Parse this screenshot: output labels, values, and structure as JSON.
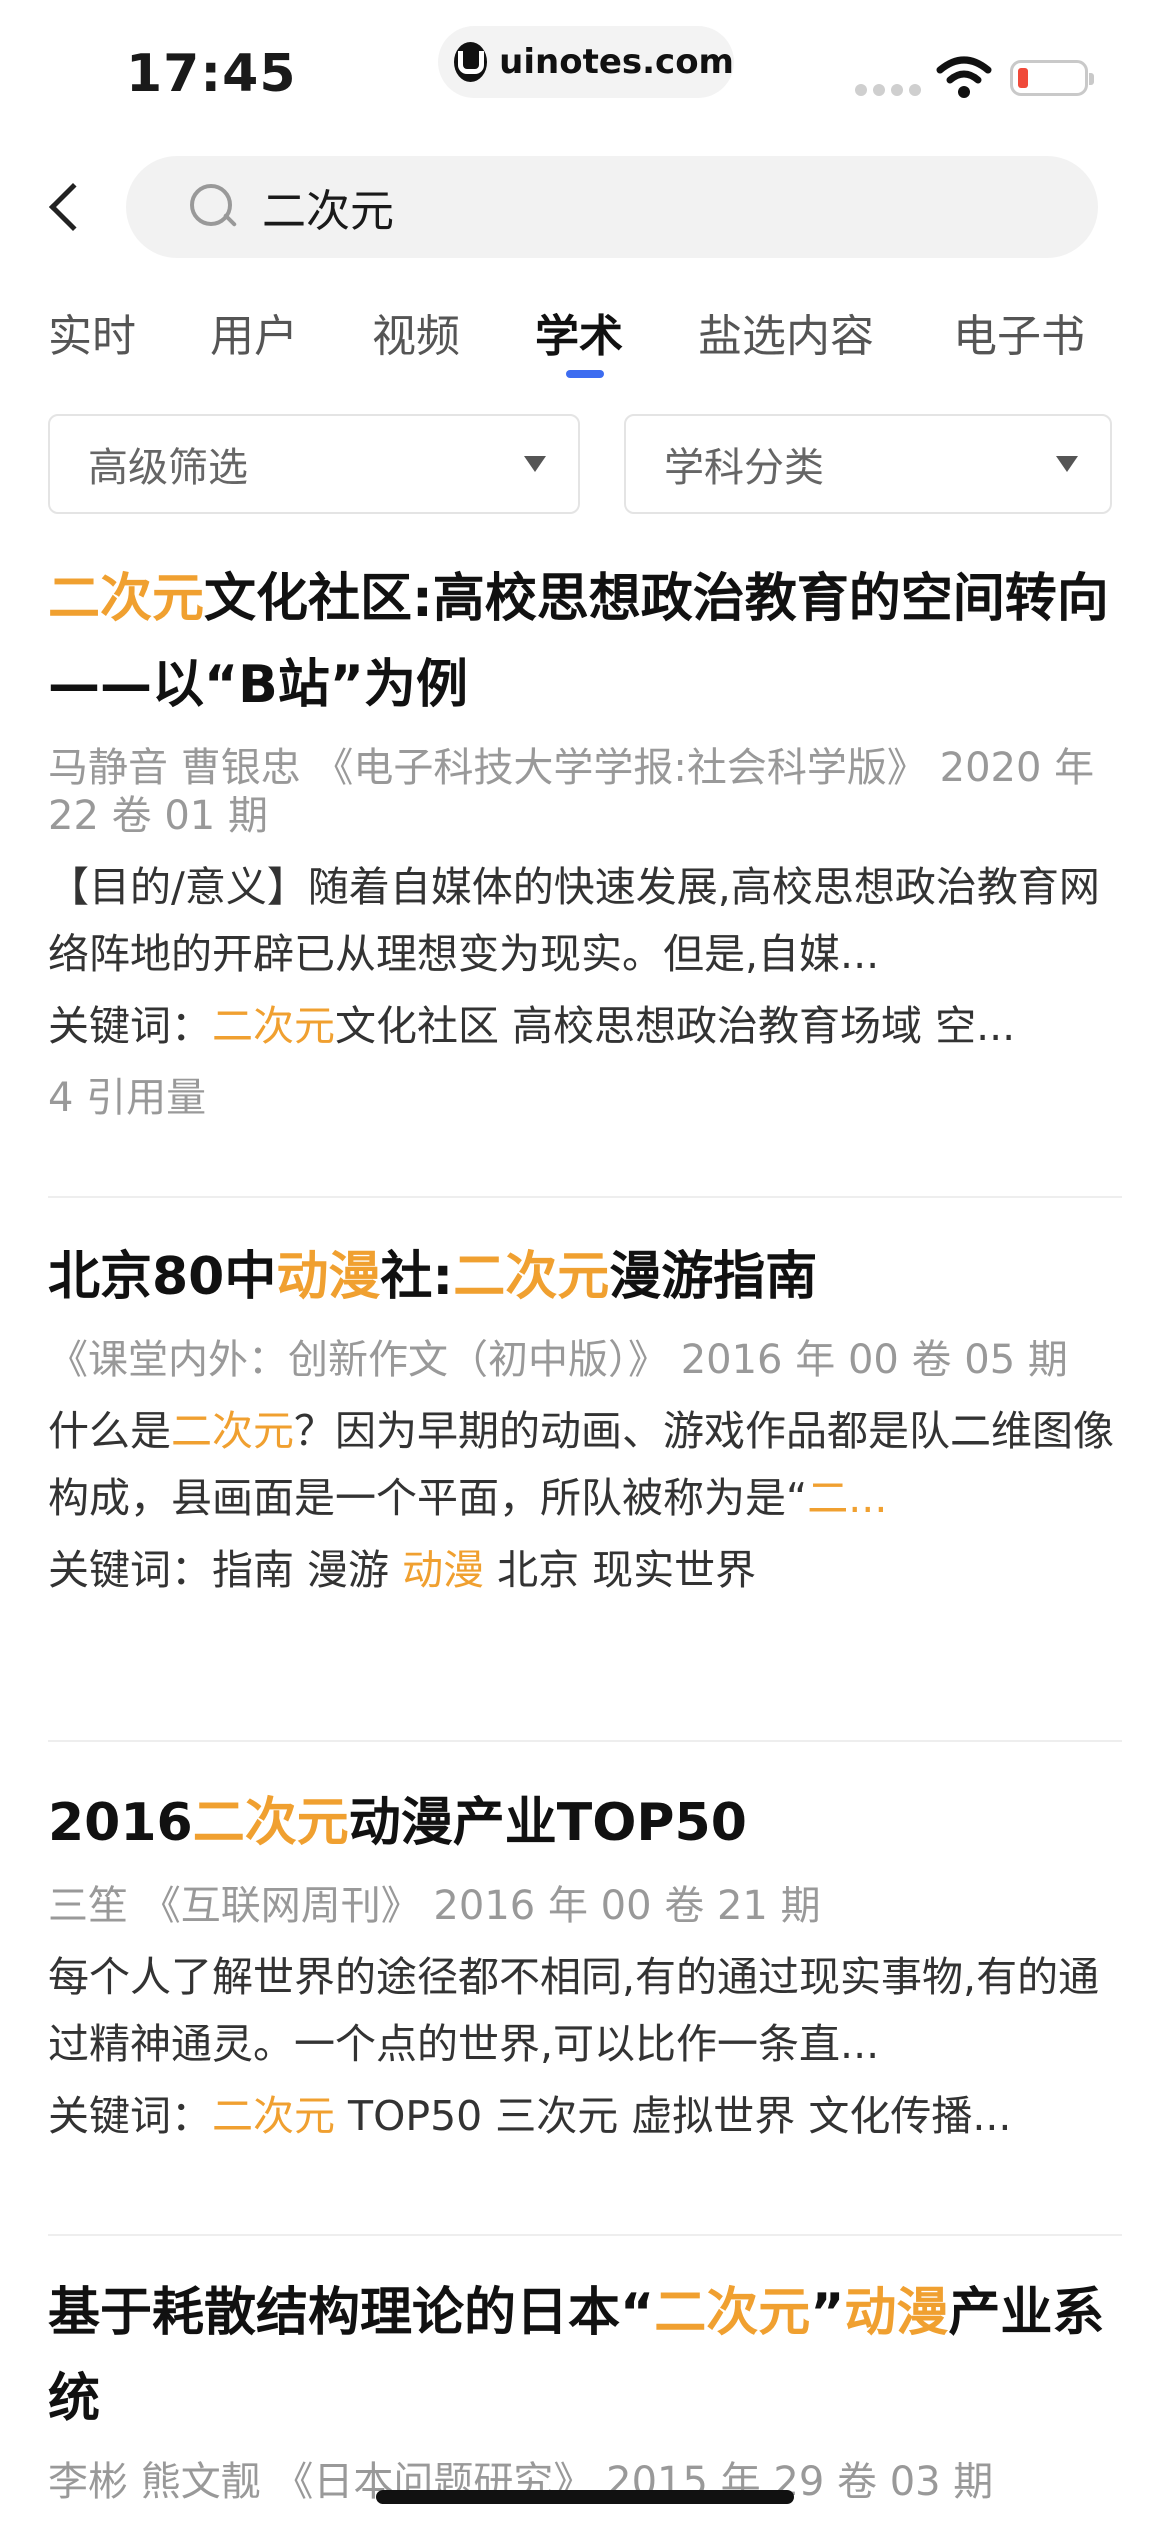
{
  "status_bar": {
    "time": "17:45",
    "url": "uinotes.com",
    "icons": [
      "cellular-signal-icon",
      "wifi-icon",
      "battery-low-icon"
    ]
  },
  "search": {
    "query": "二次元",
    "back_icon": "chevron-left-icon",
    "search_icon": "magnifier-icon"
  },
  "tabs": [
    {
      "label": "实时",
      "active": false
    },
    {
      "label": "用户",
      "active": false
    },
    {
      "label": "视频",
      "active": false
    },
    {
      "label": "学术",
      "active": true
    },
    {
      "label": "盐选内容",
      "active": false
    },
    {
      "label": "电子书",
      "active": false
    }
  ],
  "filters": [
    {
      "label": "高级筛选",
      "icon": "dropdown-caret-icon"
    },
    {
      "label": "学科分类",
      "icon": "dropdown-caret-icon"
    }
  ],
  "colors": {
    "highlight": "#f0a030",
    "tab_indicator": "#3d6cf0",
    "battery_low": "#f04a3a"
  },
  "results": [
    {
      "title": [
        {
          "text": "二次元",
          "hl": true
        },
        {
          "text": "文化社区:高校思想政治教育的空间转向——以“B站”为例",
          "hl": false
        }
      ],
      "meta": "马静音 曹银忠 《电子科技大学学报:社会科学版》 2020 年 22 卷 01 期",
      "abstract": [
        {
          "text": "【目的/意义】随着自媒体的快速发展,高校思想政治教育网络阵地的开辟已从理想变为现实。但是,自媒...",
          "hl": false
        }
      ],
      "keywords": [
        {
          "text": "关键词：",
          "hl": false
        },
        {
          "text": "二次元",
          "hl": true
        },
        {
          "text": "文化社区 高校思想政治教育场域 空...",
          "hl": false
        }
      ],
      "cites": "4 引用量"
    },
    {
      "title": [
        {
          "text": "北京80中",
          "hl": false
        },
        {
          "text": "动漫",
          "hl": true
        },
        {
          "text": "社:",
          "hl": false
        },
        {
          "text": "二次元",
          "hl": true
        },
        {
          "text": "漫游指南",
          "hl": false
        }
      ],
      "meta": "《课堂内外：创新作文（初中版）》 2016 年 00 卷 05 期",
      "abstract": [
        {
          "text": "什么是",
          "hl": false
        },
        {
          "text": "二次元",
          "hl": true
        },
        {
          "text": "？因为早期的动画、游戏作品都是队二维图像构成，县画面是一个平面，所队被称为是“",
          "hl": false
        },
        {
          "text": "二...",
          "hl": true
        }
      ],
      "keywords": [
        {
          "text": "关键词：指南 漫游 ",
          "hl": false
        },
        {
          "text": "动漫",
          "hl": true
        },
        {
          "text": " 北京 现实世界",
          "hl": false
        }
      ],
      "cites": ""
    },
    {
      "title": [
        {
          "text": "2016",
          "hl": false
        },
        {
          "text": "二次元",
          "hl": true
        },
        {
          "text": "动漫产业TOP50",
          "hl": false
        }
      ],
      "meta": "三笙 《互联网周刊》 2016 年 00 卷 21 期",
      "abstract": [
        {
          "text": "每个人了解世界的途径都不相同,有的通过现实事物,有的通过精神通灵。一个点的世界,可以比作一条直...",
          "hl": false
        }
      ],
      "keywords": [
        {
          "text": "关键词：",
          "hl": false
        },
        {
          "text": "二次元",
          "hl": true
        },
        {
          "text": " TOP50 三次元 虚拟世界 文化传播...",
          "hl": false
        }
      ],
      "cites": ""
    },
    {
      "title": [
        {
          "text": "基于耗散结构理论的日本“",
          "hl": false
        },
        {
          "text": "二次元",
          "hl": true
        },
        {
          "text": "”",
          "hl": false
        },
        {
          "text": "动漫",
          "hl": true
        },
        {
          "text": "产业系统",
          "hl": false
        }
      ],
      "meta": "李彬 熊文靓 《日本问题研究》 2015 年 29 卷 03 期",
      "abstract": [],
      "keywords": [],
      "cites": ""
    }
  ]
}
